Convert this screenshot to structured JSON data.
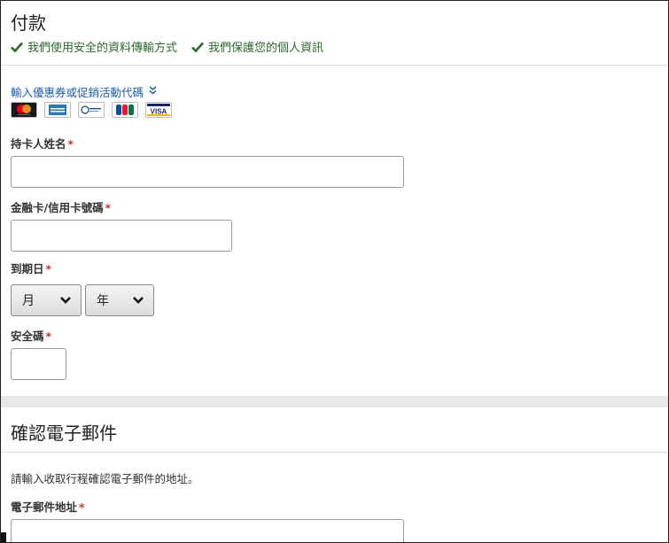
{
  "payment": {
    "title": "付款",
    "secure": [
      "我們使用安全的資料傳輸方式",
      "我們保護您的個人資訊"
    ],
    "promo_label": "輸入優惠券或促銷活動代碼",
    "cards": [
      "mastercard-icon",
      "amex-icon",
      "diners-club-icon",
      "jcb-icon",
      "visa-icon"
    ],
    "cardholder_label": "持卡人姓名",
    "card_number_label": "金融卡/信用卡號碼",
    "expiry_label": "到期日",
    "month_value": "月",
    "year_value": "年",
    "cvv_label": "安全碼",
    "required_mark": "*"
  },
  "confirm": {
    "title": "確認電子郵件",
    "hint": "請輸入收取行程確認電子郵件的地址。",
    "email_label": "電子郵件地址"
  },
  "colors": {
    "accent_green": "#2a6b27",
    "link_blue": "#1d5fa8",
    "required_red": "#c0392b"
  }
}
